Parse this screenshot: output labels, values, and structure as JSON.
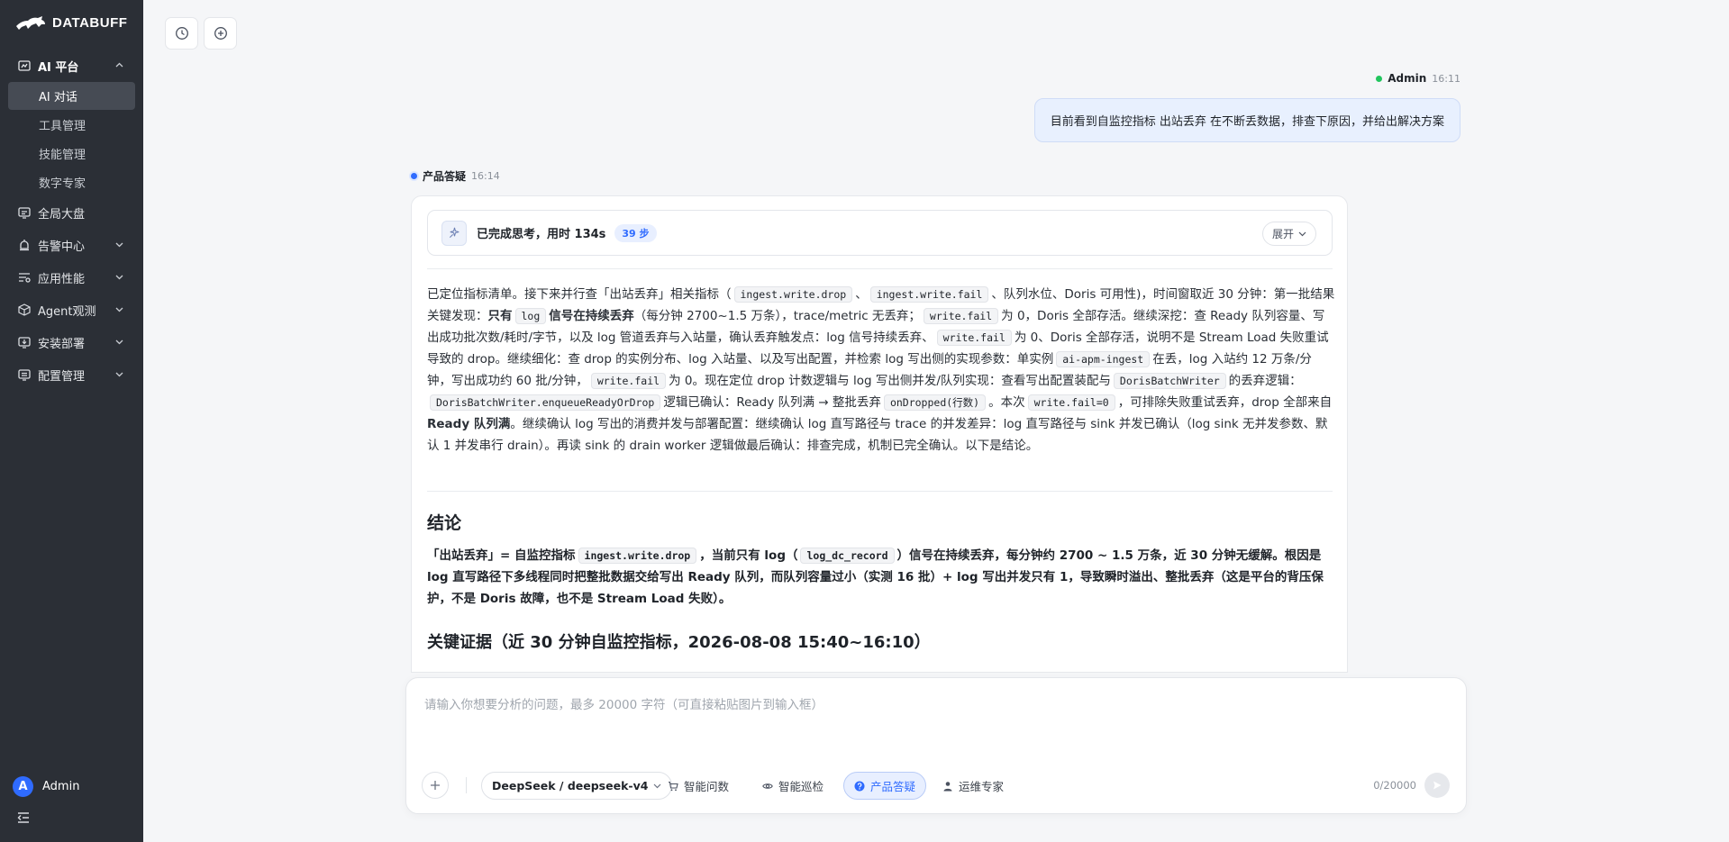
{
  "brand": {
    "name": "DATABUFF"
  },
  "sidebar": {
    "groups": [
      {
        "label": "AI 平台",
        "icon": "ai-platform-icon",
        "expanded": true,
        "items": [
          {
            "label": "AI 对话",
            "active": true
          },
          {
            "label": "工具管理"
          },
          {
            "label": "技能管理"
          },
          {
            "label": "数字专家"
          }
        ]
      },
      {
        "label": "全局大盘",
        "icon": "dashboard-icon"
      },
      {
        "label": "告警中心",
        "icon": "alert-icon"
      },
      {
        "label": "应用性能",
        "icon": "performance-icon"
      },
      {
        "label": "Agent观测",
        "icon": "agent-icon"
      },
      {
        "label": "安装部署",
        "icon": "install-icon"
      },
      {
        "label": "配置管理",
        "icon": "config-icon"
      }
    ],
    "user": {
      "initial": "A",
      "name": "Admin"
    }
  },
  "user_message": {
    "name": "Admin",
    "time": "16:11",
    "text": "目前看到自监控指标 出站丢弃 在不断丢数据，排查下原因，并给出解决方案"
  },
  "bot_message": {
    "name": "产品答疑",
    "time": "16:14",
    "thinking": {
      "text": "已完成思考，用时 134s",
      "steps": "39 步",
      "expand_label": "展开"
    },
    "paragraph": {
      "s1": "已定位指标清单。接下来并行查「出站丢弃」相关指标（",
      "c1": "ingest.write.drop",
      "s2": "、",
      "c2": "ingest.write.fail",
      "s3": "、队列水位、Doris 可用性)，时间窗取近 30 分钟：第一批结果关键发现：",
      "b1": "只有",
      "c3": "log",
      "b2": "信号在持续丢弃",
      "s4": "（每分钟 2700~1.5 万条），trace/metric 无丢弃；",
      "c4": "write.fail",
      "s5": "为 0，Doris 全部存活。继续深挖：查 Ready 队列容量、写出成功批次数/耗时/字节，以及 log 管道丢弃与入站量，确认丢弃触发点：log 信号持续丢弃、",
      "c5": "write.fail",
      "s6": "为 0、Doris 全部存活，说明不是 Stream Load 失败重试导致的 drop。继续细化：查 drop 的实例分布、log 入站量、以及写出配置，并检索 log 写出侧的实现参数：单实例",
      "c6": "ai-apm-ingest",
      "s7": "在丢，log 入站约 12 万条/分钟，写出成功约 60 批/分钟，",
      "c7": "write.fail",
      "s8": "为 0。现在定位 drop 计数逻辑与 log 写出侧并发/队列实现：查看写出配置装配与",
      "c8": "DorisBatchWriter",
      "s9": "的丢弃逻辑：",
      "c9": "DorisBatchWriter.enqueueReadyOrDrop",
      "s10": "逻辑已确认：Ready 队列满 → 整批丢弃",
      "c10": "onDropped(行数)",
      "s11": "。本次",
      "c11": "write.fail=0",
      "s12": "，可排除失败重试丢弃，drop 全部来自",
      "b3": "Ready 队列满",
      "s13": "。继续确认 log 写出的消费并发与部署配置：继续确认 log 直写路径与 trace 的并发差异：log 直写路径与 sink 并发已确认（log sink 无并发参数、默认 1 并发串行 drain）。再读 sink 的 drain worker 逻辑做最后确认：排查完成，机制已完全确认。以下是结论。"
    },
    "conclusion_title": "结论",
    "conclusion": {
      "t1": "「出站丢弃」= 自监控指标",
      "c1": "ingest.write.drop",
      "t2": "，当前只有 log（",
      "c2": "log_dc_record",
      "t3": "）信号在持续丢弃，每分钟约 2700 ~ 1.5 万条，近 30 分钟无缓解。根因是 log 直写路径下多线程同时把整批数据交给写出 Ready 队列，而队列容量过小（实测 16 批）+ log 写出并发只有 1，导致瞬时溢出、整批丢弃（这是平台的背压保护，不是 Doris 故障，也不是 Stream Load 失败）。"
    },
    "evidence_title": "关键证据（近 30 分钟自监控指标，2026-08-08 15:40~16:10）"
  },
  "composer": {
    "placeholder": "请输入你想要分析的问题，最多 20000 字符（可直接粘贴图片到输入框）",
    "model": "DeepSeek / deepseek-v4",
    "modes": [
      {
        "label": "智能问数",
        "icon": "cart-icon"
      },
      {
        "label": "智能巡检",
        "icon": "eye-icon"
      },
      {
        "label": "产品答疑",
        "icon": "question-icon",
        "selected": true
      },
      {
        "label": "运维专家",
        "icon": "person-icon"
      }
    ],
    "counter": "0/20000"
  },
  "colors": {
    "accent": "#2f6bff",
    "sidebar_bg": "#2b2f36",
    "online": "#22c55e"
  }
}
